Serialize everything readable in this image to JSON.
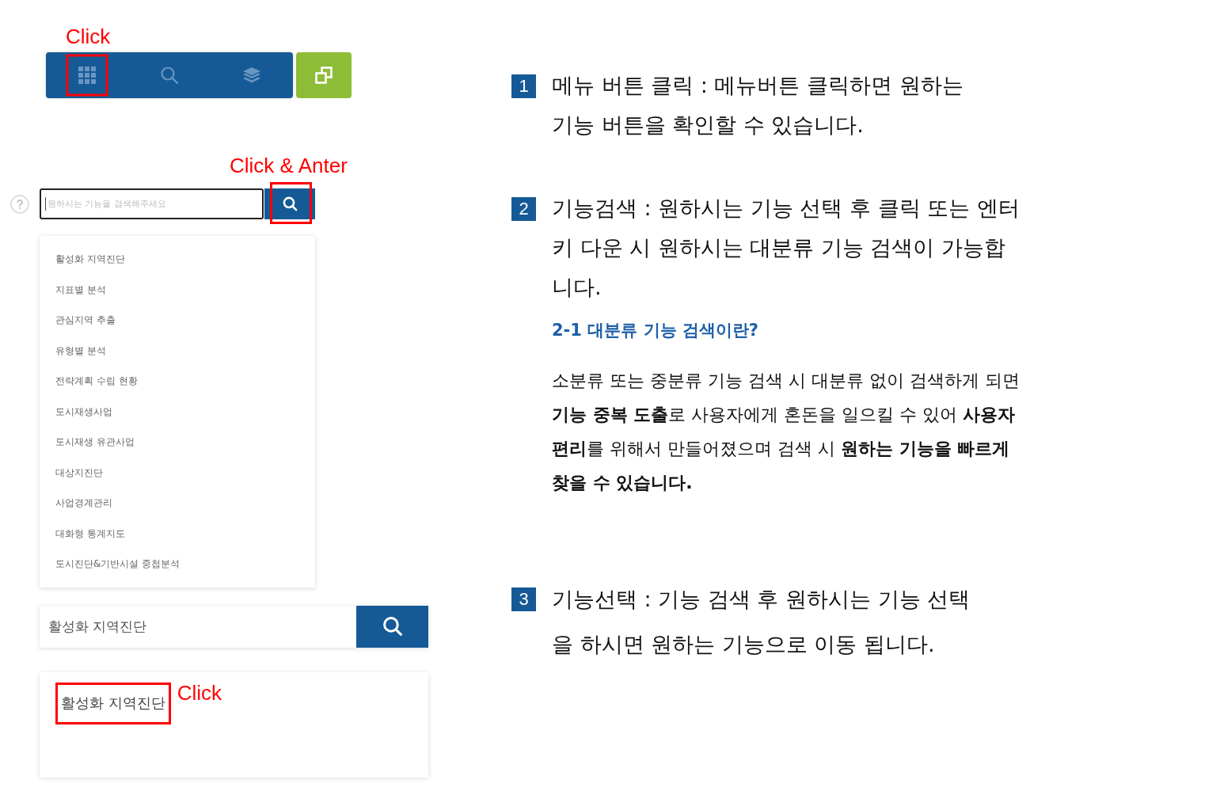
{
  "toolbar": {
    "annotation": "Click",
    "tools": [
      {
        "kind": "grid",
        "highlighted": true
      },
      {
        "kind": "search",
        "highlighted": false
      },
      {
        "kind": "layers",
        "highlighted": false
      }
    ]
  },
  "search": {
    "annotation": "Click & Anter",
    "placeholder": "원하시는 기능을 검색해주세요",
    "focused": true,
    "button_highlighted": true
  },
  "suggestions": [
    "활성화 지역진단",
    "지표별 분석",
    "관심지역 추출",
    "유형별 분석",
    "전략계획 수립 현황",
    "도시재생사업",
    "도시재생 유관사업",
    "대상지진단",
    "사업경계관리",
    "대화형 통계지도",
    "도시진단&기반시설 중첩분석"
  ],
  "search_bar": {
    "value": "활성화 지역진단"
  },
  "results": {
    "items": [
      {
        "label": "활성화 지역진단",
        "highlighted": true
      }
    ],
    "annotation": "Click"
  },
  "steps": [
    {
      "number": "1",
      "text": "메뉴 버튼 클릭 : 메뉴버튼 클릭하면 원하는\n기능 버튼을 확인할 수 있습니다."
    },
    {
      "number": "2",
      "text": "기능검색 : 원하시는 기능 선택 후 클릭 또는 엔터\n키 다운 시 원하시는 대분류 기능 검색이 가능합\n니다.",
      "subsection": {
        "title": "2-1 대분류 기능 검색이란?",
        "text": "소분류 또는 중분류 기능 검색 시 대분류 없이 검색하게 되면\n**기능 중복 도출**로 사용자에게 혼돈을 일으킬 수 있어 **사용자**\n**편리**를 위해서 만들어졌으며 검색 시 **원하는 기능을 빠르게**\n**찾을 수 있습니다.**"
      }
    },
    {
      "number": "3",
      "text": "기능선택 : 기능 검색 후 원하시는 기능 선택\n을 하시면 원하는 기능으로 이동 됩니다."
    }
  ]
}
